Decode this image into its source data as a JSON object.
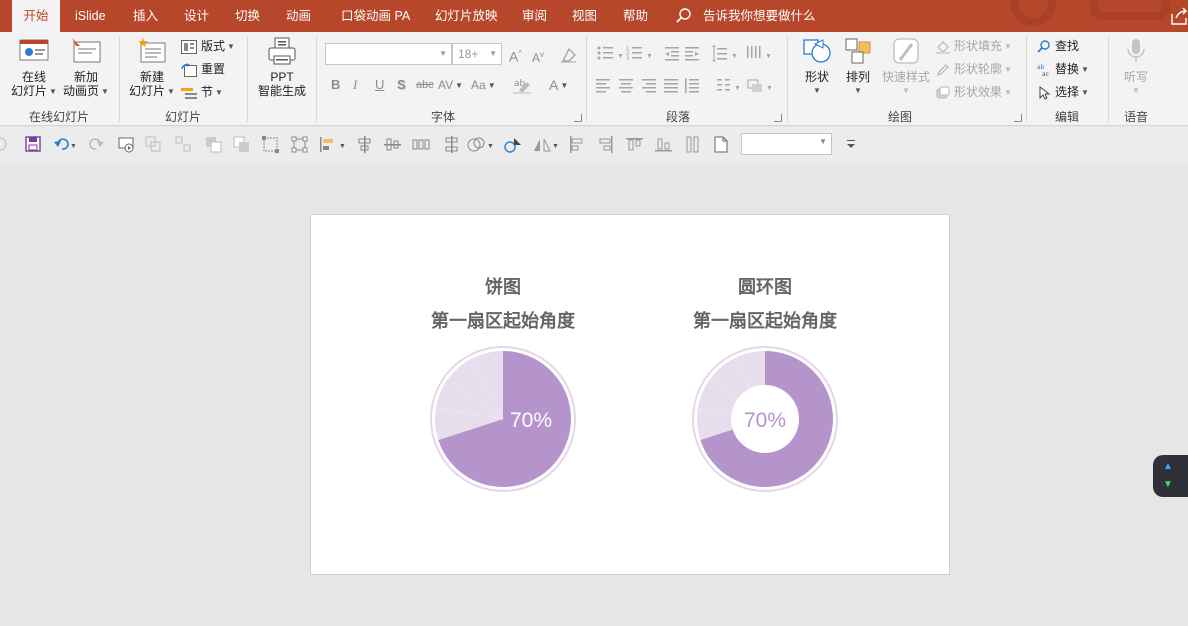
{
  "tabs": [
    {
      "label": "开始",
      "active": true
    },
    {
      "label": "iSlide"
    },
    {
      "label": "插入"
    },
    {
      "label": "设计"
    },
    {
      "label": "切换"
    },
    {
      "label": "动画"
    },
    {
      "label": "口袋动画 PA"
    },
    {
      "label": "幻灯片放映"
    },
    {
      "label": "审阅"
    },
    {
      "label": "视图"
    },
    {
      "label": "帮助"
    }
  ],
  "tell_me": {
    "label": "告诉我你想要做什么",
    "icon": "search-icon"
  },
  "ribbon": {
    "online_slides": {
      "btn1": [
        "在线",
        "幻灯片"
      ],
      "btn2": [
        "新加",
        "动画页"
      ],
      "group": "在线幻灯片"
    },
    "slides": {
      "new_slide": [
        "新建",
        "幻灯片"
      ],
      "layout": "版式",
      "reset": "重置",
      "section": "节",
      "group": "幻灯片"
    },
    "ppt_ai": {
      "label1": "PPT",
      "label2": "智能生成"
    },
    "font": {
      "size_placeholder": "18+",
      "group": "字体",
      "glyphs": {
        "grow": "A",
        "shrink": "A",
        "bold": "B",
        "italic": "I",
        "underline": "U",
        "shadow": "S",
        "strike": "abc",
        "spacing": "AV",
        "case": "Aa",
        "color": "A"
      }
    },
    "paragraph": {
      "group": "段落"
    },
    "drawing": {
      "shape": "形状",
      "arrange": "排列",
      "quick_style": "快速样式",
      "fill": "形状填充",
      "outline": "形状轮廓",
      "effect": "形状效果",
      "group": "绘图"
    },
    "editing": {
      "find": "查找",
      "replace": "替换",
      "select": "选择",
      "group": "编辑"
    },
    "voice": {
      "dictate": "听写",
      "group": "语音"
    }
  },
  "slide": {
    "charts": [
      {
        "title1": "饼图",
        "title2": "第一扇区起始角度",
        "value_label": "70%",
        "kind": "pie",
        "fill": "#b594cc",
        "remainder": "#e6dded"
      },
      {
        "title1": "圆环图",
        "title2": "第一扇区起始角度",
        "value_label": "70%",
        "kind": "donut",
        "fill": "#b594cc",
        "remainder": "#e6dded"
      }
    ]
  },
  "chart_data": [
    {
      "type": "pie",
      "values": [
        70,
        30
      ],
      "data_labels": [
        "70%"
      ]
    },
    {
      "type": "pie",
      "values": [
        70,
        30
      ],
      "data_labels": [
        "70%"
      ]
    }
  ],
  "colors": {
    "accent": "#b7472a",
    "ribbon_bg": "#f3f3f3",
    "chart_main": "#b594cc",
    "chart_rest": "#e6dded"
  }
}
